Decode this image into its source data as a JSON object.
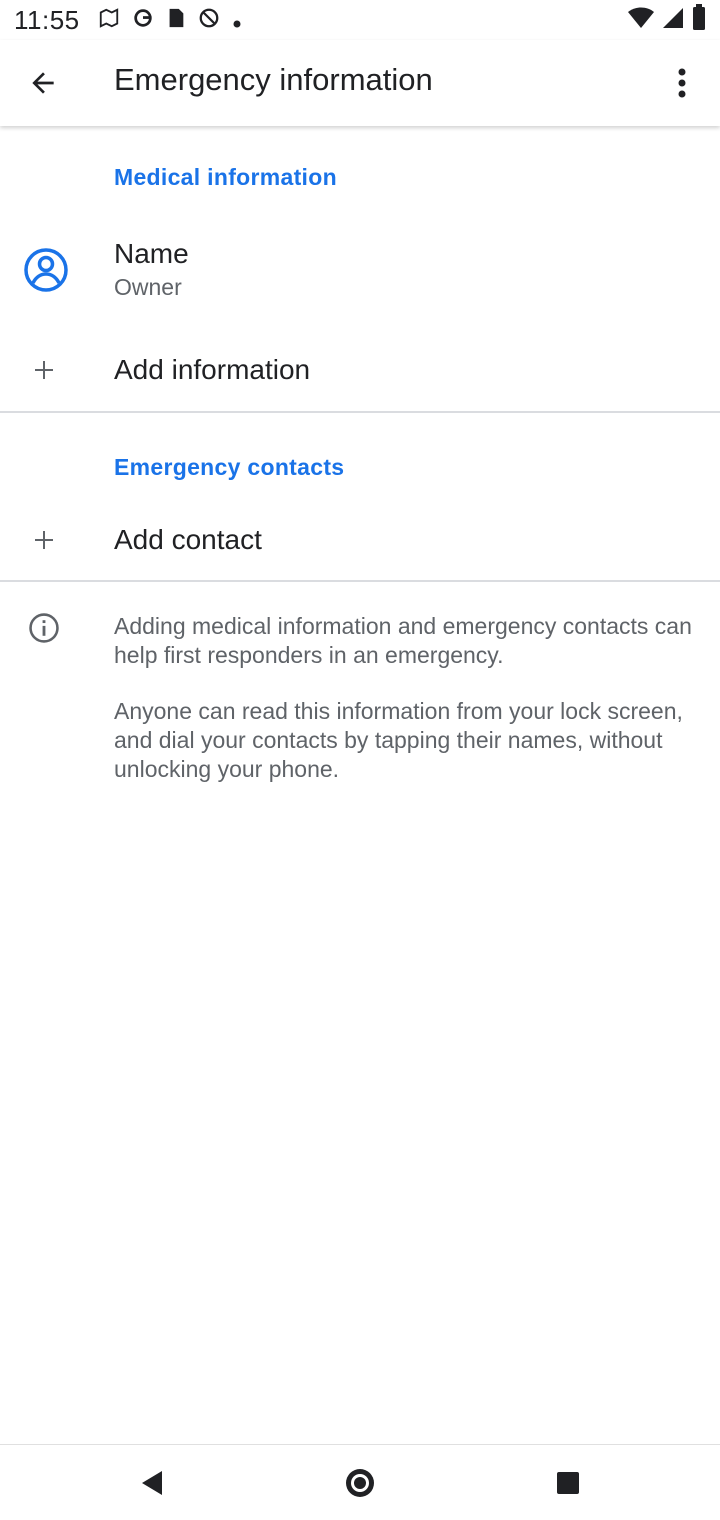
{
  "status_bar": {
    "time": "11:55",
    "left_icons": [
      "maps-icon",
      "google-icon",
      "sim-card-icon",
      "do-not-disturb-icon",
      "dot-icon"
    ],
    "right_icons": [
      "wifi-icon",
      "signal-icon",
      "battery-icon"
    ]
  },
  "app_bar": {
    "title": "Emergency information",
    "back_icon": "arrow-back-icon",
    "menu_icon": "more-vert-icon"
  },
  "medical": {
    "header": "Medical information",
    "name_title": "Name",
    "name_value": "Owner",
    "add_label": "Add information"
  },
  "contacts": {
    "header": "Emergency contacts",
    "add_label": "Add contact"
  },
  "info": {
    "paragraph1": "Adding medical information and emergency contacts can help first responders in an emergency.",
    "paragraph2": "Anyone can read this information from your lock screen, and dial your contacts by tapping their names, without unlocking your phone."
  },
  "nav_bar": {
    "buttons": [
      "back-triangle-icon",
      "home-circle-icon",
      "recents-square-icon"
    ]
  },
  "colors": {
    "accent": "#1a73e8",
    "text_primary": "#202124",
    "text_secondary": "#5f6368",
    "divider": "#dadce0"
  }
}
